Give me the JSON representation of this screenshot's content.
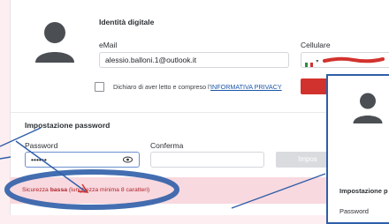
{
  "profile": {
    "section_title": "Identità digitale",
    "email_label": "eMail",
    "email_value": "alessio.balloni.1@outlook.it",
    "phone_label": "Cellulare",
    "phone_prefix_icon": "italy-flag-icon",
    "consent_prefix": "Dichiaro di aver letto e compreso l'",
    "consent_link": "INFORMATIVA PRIVACY"
  },
  "password_section": {
    "title": "Impostazione password",
    "password_label": "Password",
    "password_value": "••••••",
    "confirm_label": "Conferma",
    "confirm_value": "",
    "submit_label": "Impos",
    "alert_prefix": "Sicurezza ",
    "alert_strength": "bassa",
    "alert_suffix": " (lunghezza minima 8 caratteri)"
  },
  "overlay": {
    "title": "Impostazione p",
    "password_label": "Password"
  },
  "colors": {
    "accent_red": "#d2322d",
    "annotation_blue": "#2f5ea8",
    "alert_bg": "#f8d9df",
    "alert_text": "#b0232b"
  }
}
